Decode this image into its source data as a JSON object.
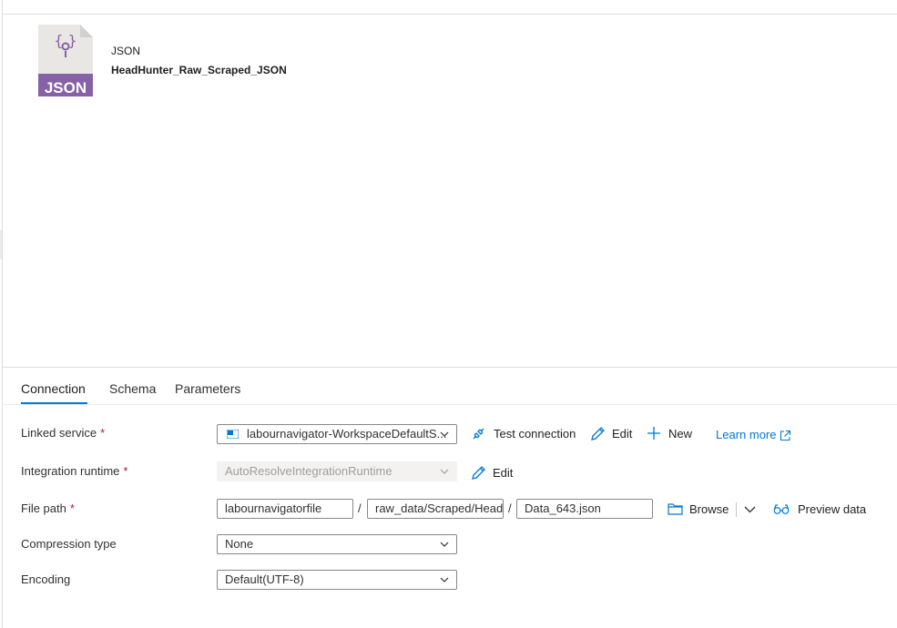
{
  "dataset": {
    "type_label": "JSON",
    "name": "HeadHunter_Raw_Scraped_JSON",
    "icon_text": "JSON",
    "icon": "json-file-icon"
  },
  "tabs": [
    {
      "label": "Connection",
      "active": true
    },
    {
      "label": "Schema",
      "active": false
    },
    {
      "label": "Parameters",
      "active": false
    }
  ],
  "form": {
    "required_marker": "*",
    "linked_service": {
      "label": "Linked service",
      "value": "labournavigator-WorkspaceDefaultS...",
      "actions": {
        "test_connection": "Test connection",
        "edit": "Edit",
        "new": "New",
        "learn_more": "Learn more"
      }
    },
    "integration_runtime": {
      "label": "Integration runtime",
      "value": "AutoResolveIntegrationRuntime",
      "edit": "Edit"
    },
    "file_path": {
      "label": "File path",
      "container": "labournavigatorfile",
      "directory": "raw_data/Scraped/Head",
      "file": "Data_643.json",
      "separator": "/",
      "browse": "Browse",
      "preview": "Preview data"
    },
    "compression_type": {
      "label": "Compression type",
      "value": "None"
    },
    "encoding": {
      "label": "Encoding",
      "value": "Default(UTF-8)"
    }
  },
  "colors": {
    "accent": "#0078d4",
    "icon_purple": "#8661a5",
    "required": "#a4262c"
  }
}
